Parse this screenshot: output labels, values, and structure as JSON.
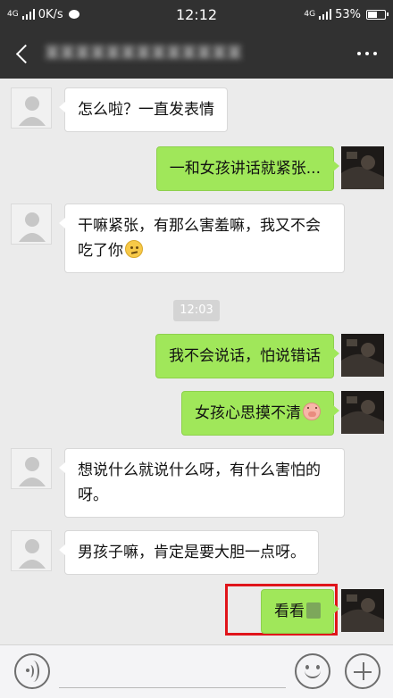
{
  "status_bar": {
    "network": "4G",
    "speed": "0K/s",
    "time": "12:12",
    "network_right": "4G",
    "battery": "53%",
    "battery_level": 0.53
  },
  "header": {
    "title": "某某某某某某某某某某某某某"
  },
  "messages": [
    {
      "sender": "other",
      "text": "怎么啦？一直发表情"
    },
    {
      "sender": "self",
      "text": "一和女孩讲话就紧张..."
    },
    {
      "sender": "other",
      "text": "干嘛紧张，有那么害羞嘛，我又不会吃了你",
      "emoji": "thinking-emoji"
    },
    {
      "sender": "self",
      "text": "我不会说话，怕说错话"
    },
    {
      "sender": "self",
      "text": "女孩心思摸不清",
      "emoji": "pig-emoji"
    },
    {
      "sender": "other",
      "text": "想说什么就说什么呀，有什么害怕的呀。"
    },
    {
      "sender": "other",
      "text": "男孩子嘛，肯定是要大胆一点呀。"
    },
    {
      "sender": "self",
      "text": "看看",
      "emoji": "sticker-emoji",
      "highlighted": true
    }
  ],
  "timestamp": "12:03",
  "input": {
    "value": "",
    "placeholder": ""
  },
  "colors": {
    "bar_bg": "#313131",
    "chat_bg": "#ebebeb",
    "bubble_self": "#a0e75a",
    "bubble_other": "#ffffff",
    "highlight": "#e0141a"
  }
}
